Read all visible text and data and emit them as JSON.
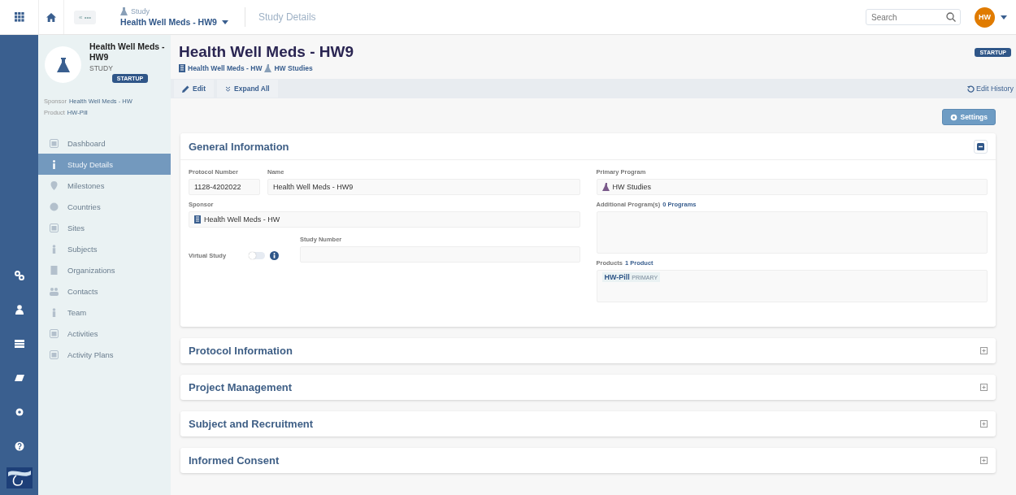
{
  "topbar": {
    "breadcrumb": {
      "back": "« •••",
      "study_label": "Study",
      "study_name": "Health Well Meds - HW9",
      "current": "Study Details"
    },
    "search": {
      "placeholder": "Search"
    },
    "user": {
      "initials": "HW"
    }
  },
  "sidebar": {
    "title": "Health Well Meds - HW9",
    "type": "STUDY",
    "status": "STARTUP",
    "meta": [
      {
        "label": "Sponsor",
        "value": "Health Well Meds - HW"
      },
      {
        "label": "Product",
        "value": "HW-Pill"
      }
    ],
    "items": [
      {
        "label": "Dashboard",
        "selected": false
      },
      {
        "label": "Study Details",
        "selected": true
      },
      {
        "label": "Milestones",
        "selected": false
      },
      {
        "label": "Countries",
        "selected": false
      },
      {
        "label": "Sites",
        "selected": false
      },
      {
        "label": "Subjects",
        "selected": false
      },
      {
        "label": "Organizations",
        "selected": false
      },
      {
        "label": "Contacts",
        "selected": false
      },
      {
        "label": "Team",
        "selected": false
      },
      {
        "label": "Activities",
        "selected": false
      },
      {
        "label": "Activity Plans",
        "selected": false
      }
    ]
  },
  "header": {
    "title": "Health Well Meds - HW9",
    "sponsor_link": "Health Well Meds - HW",
    "program_link": "HW Studies",
    "status": "STARTUP"
  },
  "toolbar": {
    "edit": "Edit",
    "expand_all": "Expand All",
    "history": "Edit History",
    "settings": "Settings"
  },
  "sections": [
    {
      "title": "General Information",
      "expanded": true
    },
    {
      "title": "Protocol Information",
      "expanded": false
    },
    {
      "title": "Project Management",
      "expanded": false
    },
    {
      "title": "Subject and Recruitment",
      "expanded": false
    },
    {
      "title": "Informed Consent",
      "expanded": false
    }
  ],
  "general": {
    "protocol_number": {
      "label": "Protocol Number",
      "value": "1128-4202022"
    },
    "name": {
      "label": "Name",
      "value": "Health Well Meds - HW9"
    },
    "sponsor": {
      "label": "Sponsor",
      "value": "Health Well Meds - HW"
    },
    "virtual_study": {
      "label": "Virtual Study",
      "on": false
    },
    "study_number": {
      "label": "Study Number"
    },
    "primary_program": {
      "label": "Primary Program",
      "value": "HW Studies"
    },
    "additional_programs": {
      "label": "Additional Program(s)",
      "count": "0 Programs"
    },
    "products": {
      "label": "Products",
      "count": "1 Product",
      "items": [
        {
          "name": "HW-Pill",
          "tag": "PRIMARY"
        }
      ]
    }
  }
}
